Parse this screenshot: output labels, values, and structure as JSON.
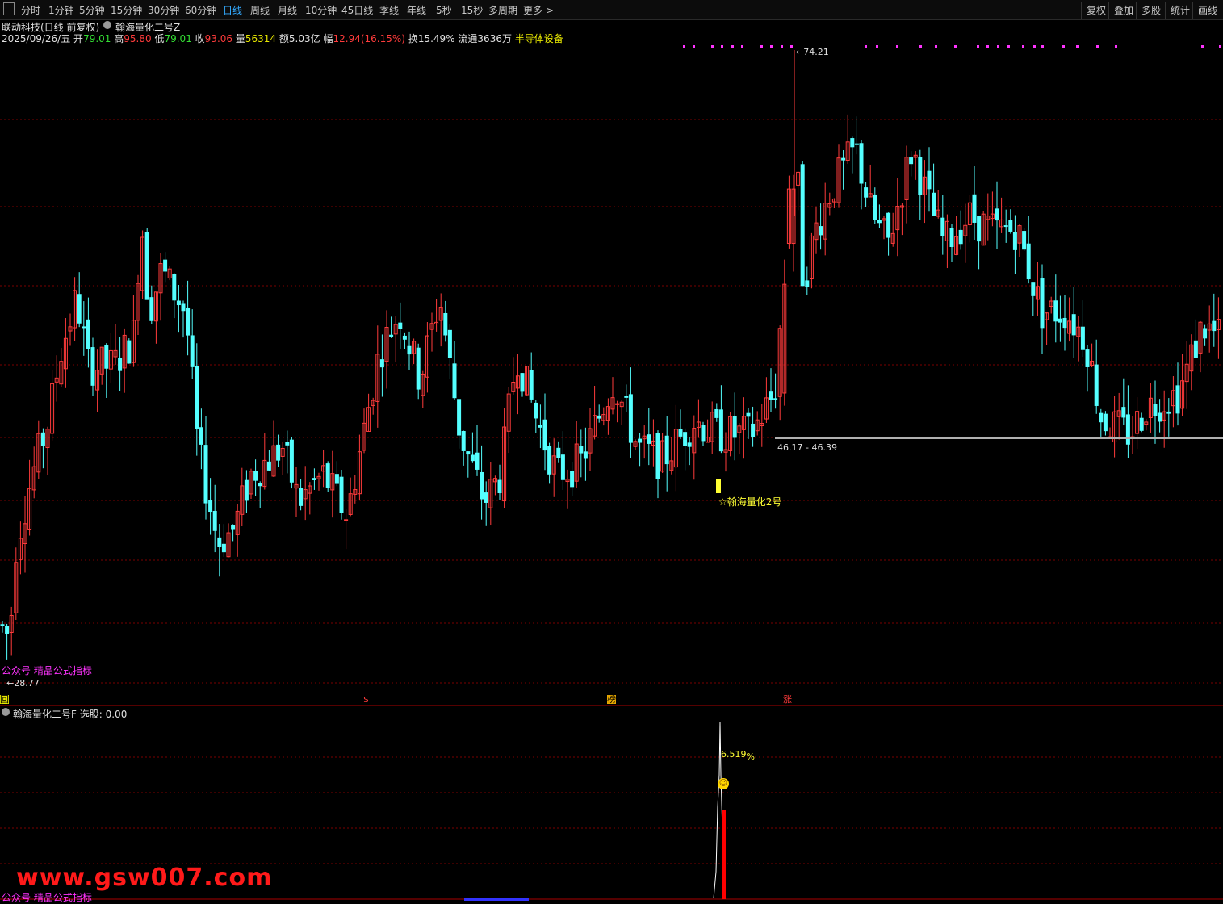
{
  "toolbar": {
    "periods": [
      "分时",
      "1分钟",
      "5分钟",
      "15分钟",
      "30分钟",
      "60分钟",
      "日线",
      "周线",
      "月线",
      "10分钟",
      "45日线",
      "季线",
      "年线",
      "5秒",
      "15秒",
      "多周期",
      "更多 >"
    ],
    "active": "日线",
    "right_buttons": [
      "复权",
      "叠加",
      "多股",
      "统计",
      "画线"
    ]
  },
  "header": {
    "stock_name": "联动科技(日线 前复权)",
    "indicator_name": "翰海量化二号Z",
    "date": "2025/09/26/五",
    "open_label": "开",
    "open": "79.01",
    "high_label": "高",
    "high": "95.80",
    "low_label": "低",
    "low": "79.01",
    "close_label": "收",
    "close": "93.06",
    "volume_label": "量",
    "volume": "56314",
    "amount_label": "额",
    "amount": "5.03亿",
    "change_label": "幅",
    "change": "12.94(16.15%)",
    "turnover_label": "换",
    "turnover": "15.49%",
    "float_label": "流通",
    "float": "3636万",
    "sector": "半导体设备"
  },
  "main_chart": {
    "max_label": "74.21",
    "min_label": "28.77",
    "range_label": "46.17 - 46.39",
    "signal_label": "☆翰海量化2号",
    "promo_text": "公众号 精品公式指标",
    "markers": [
      "回",
      "$",
      "榜",
      "涨"
    ]
  },
  "sub_chart": {
    "title": "翰海量化二号F",
    "select_label": "选股:",
    "select_value": "0.00",
    "pct_label": "6.519",
    "pct_suffix": "%",
    "promo_text": "公众号 精品公式指标"
  },
  "watermark": "www.gsw007.com",
  "colors": {
    "up": "#ff3b3b",
    "down": "#54ffff",
    "grid": "#7a0000",
    "magenta": "#ff33ff",
    "yellow": "#ffff33"
  }
}
